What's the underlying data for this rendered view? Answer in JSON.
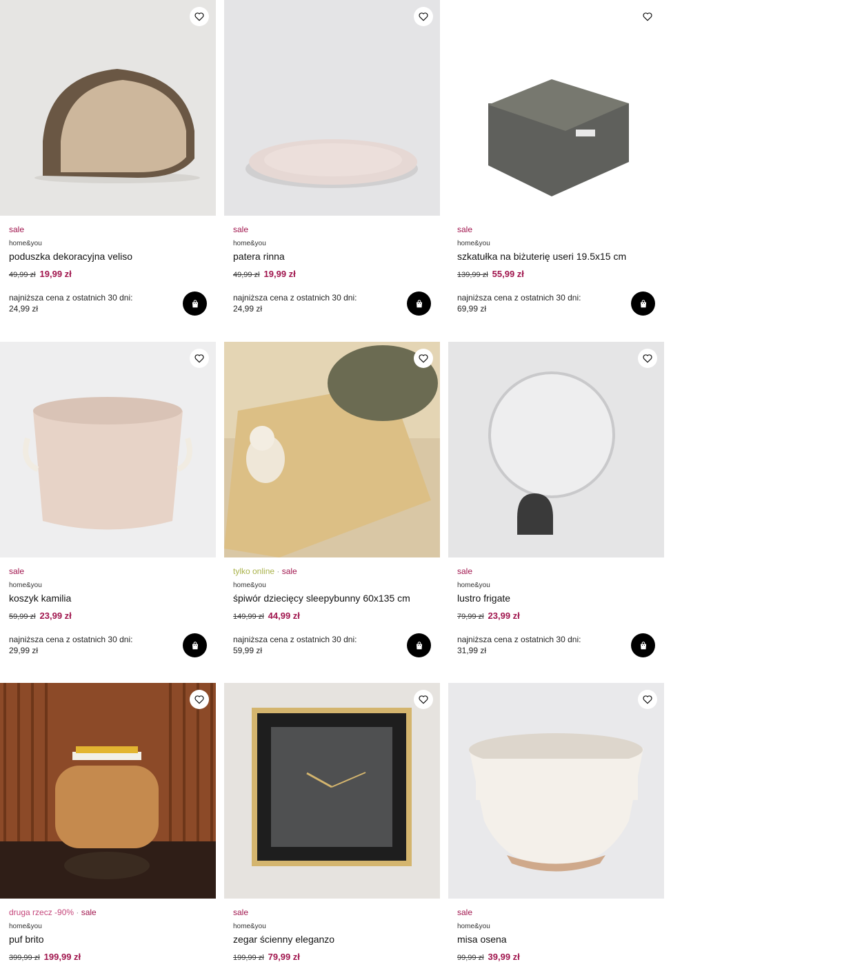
{
  "products": [
    {
      "badges": [
        {
          "text": "sale",
          "kind": "sale"
        }
      ],
      "brand": "home&you",
      "name": "poduszka dekoracyjna veliso",
      "old_price": "49,99 zł",
      "new_price": "19,99 zł",
      "lowest_label": "najniższa cena z ostatnich 30 dni:",
      "lowest_value": "24,99 zł"
    },
    {
      "badges": [
        {
          "text": "sale",
          "kind": "sale"
        }
      ],
      "brand": "home&you",
      "name": "patera rinna",
      "old_price": "49,99 zł",
      "new_price": "19,99 zł",
      "lowest_label": "najniższa cena z ostatnich 30 dni:",
      "lowest_value": "24,99 zł"
    },
    {
      "badges": [
        {
          "text": "sale",
          "kind": "sale"
        }
      ],
      "brand": "home&you",
      "name": "szkatułka na biżuterię useri 19.5x15 cm",
      "old_price": "139,99 zł",
      "new_price": "55,99 zł",
      "lowest_label": "najniższa cena z ostatnich 30 dni:",
      "lowest_value": "69,99 zł"
    },
    {
      "badges": [
        {
          "text": "sale",
          "kind": "sale"
        }
      ],
      "brand": "home&you",
      "name": "koszyk kamilia",
      "old_price": "59,99 zł",
      "new_price": "23,99 zł",
      "lowest_label": "najniższa cena z ostatnich 30 dni:",
      "lowest_value": "29,99 zł"
    },
    {
      "badges": [
        {
          "text": "tylko online",
          "kind": "online"
        },
        {
          "text": " · ",
          "kind": "dot"
        },
        {
          "text": "sale",
          "kind": "sale"
        }
      ],
      "brand": "home&you",
      "name": "śpiwór dziecięcy sleepybunny 60x135 cm",
      "old_price": "149,99 zł",
      "new_price": "44,99 zł",
      "lowest_label": "najniższa cena z ostatnich 30 dni:",
      "lowest_value": "59,99 zł"
    },
    {
      "badges": [
        {
          "text": "sale",
          "kind": "sale"
        }
      ],
      "brand": "home&you",
      "name": "lustro frigate",
      "old_price": "79,99 zł",
      "new_price": "23,99 zł",
      "lowest_label": "najniższa cena z ostatnich 30 dni:",
      "lowest_value": "31,99 zł"
    },
    {
      "badges": [
        {
          "text": "druga rzecz -90%",
          "kind": "promo"
        },
        {
          "text": " · ",
          "kind": "dot"
        },
        {
          "text": "sale",
          "kind": "sale"
        }
      ],
      "brand": "home&you",
      "name": "puf brito",
      "old_price": "399,99 zł",
      "new_price": "199,99 zł",
      "lowest_label": "",
      "lowest_value": ""
    },
    {
      "badges": [
        {
          "text": "sale",
          "kind": "sale"
        }
      ],
      "brand": "home&you",
      "name": "zegar ścienny eleganzo",
      "old_price": "199,99 zł",
      "new_price": "79,99 zł",
      "lowest_label": "",
      "lowest_value": ""
    },
    {
      "badges": [
        {
          "text": "sale",
          "kind": "sale"
        }
      ],
      "brand": "home&you",
      "name": "misa osena",
      "old_price": "99,99 zł",
      "new_price": "39,99 zł",
      "lowest_label": "",
      "lowest_value": ""
    }
  ],
  "icons": {
    "favorite": "heart-icon",
    "cart": "shopping-bag-icon"
  },
  "colors": {
    "sale": "#a0154d",
    "online": "#a9b24a",
    "promo": "#c4457a",
    "cart_bg": "#000000"
  }
}
